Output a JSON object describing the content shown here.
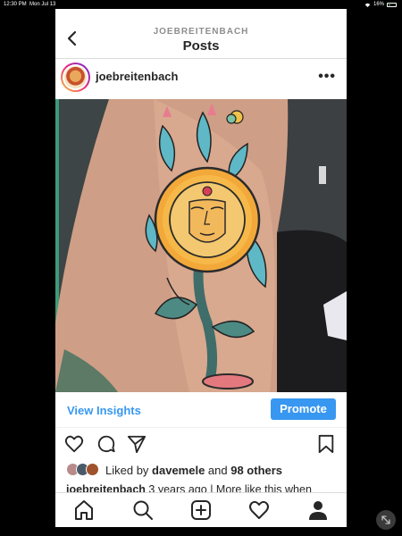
{
  "status_bar": {
    "time": "12:30 PM",
    "date": "Mon Jul 13",
    "battery": "16%"
  },
  "header": {
    "username": "JOEBREITENBACH",
    "title": "Posts"
  },
  "post": {
    "author": "joebreitenbach",
    "insights_label": "View Insights",
    "promote_label": "Promote",
    "likes": {
      "prefix": "Liked by ",
      "user": "davemele",
      "middle": " and ",
      "others": "98 others"
    },
    "caption": {
      "author": "joebreitenbach",
      "text": " 3 years ago | More like this when"
    }
  },
  "icons": [
    "back-icon",
    "more-icon",
    "heart-icon",
    "comment-icon",
    "share-icon",
    "bookmark-icon",
    "home-icon",
    "search-icon",
    "new-post-icon",
    "activity-icon",
    "profile-icon"
  ],
  "colors": {
    "accent": "#3897f0",
    "text": "#262626",
    "muted": "#8e8e8e"
  }
}
